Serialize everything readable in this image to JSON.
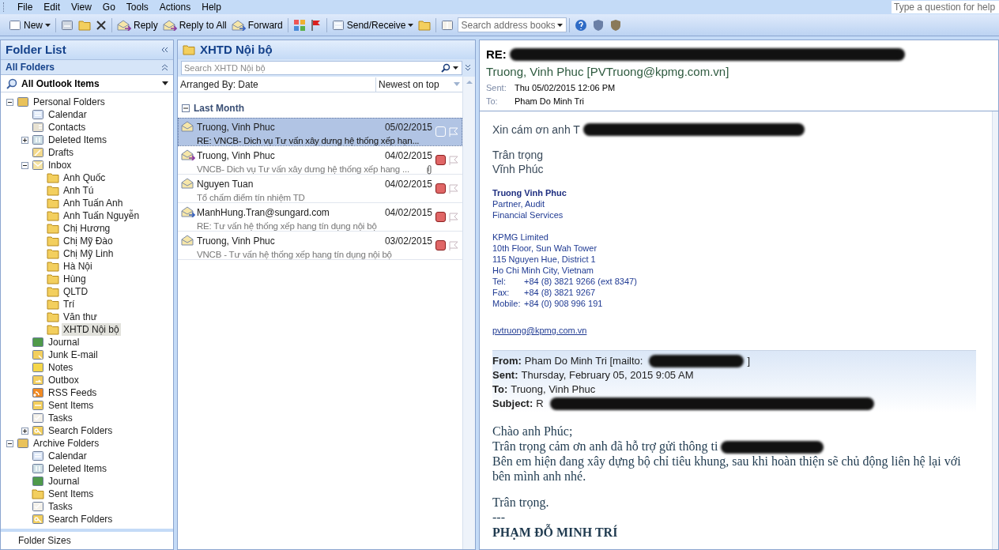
{
  "menu": [
    {
      "label": "File"
    },
    {
      "label": "Edit"
    },
    {
      "label": "View"
    },
    {
      "label": "Go"
    },
    {
      "label": "Tools"
    },
    {
      "label": "Actions"
    },
    {
      "label": "Help"
    }
  ],
  "help_box": {
    "placeholder": "Type a question for help"
  },
  "toolbar": {
    "new": "New",
    "reply": "Reply",
    "reply_all": "Reply to All",
    "forward": "Forward",
    "send_receive": "Send/Receive",
    "address_search": {
      "placeholder": "Search address books"
    }
  },
  "folder_pane": {
    "title": "Folder List",
    "section": "All Folders",
    "view_selector": "All Outlook Items",
    "footer": "Folder Sizes",
    "tree": [
      {
        "label": "Personal Folders",
        "kind": "root",
        "selected": false,
        "expanded": true,
        "children": [
          {
            "label": "Calendar",
            "kind": "calendar",
            "selected": false
          },
          {
            "label": "Contacts",
            "kind": "contacts",
            "selected": false
          },
          {
            "label": "Deleted Items",
            "kind": "deleted",
            "selected": false,
            "expanded": false
          },
          {
            "label": "Drafts",
            "kind": "drafts",
            "selected": false
          },
          {
            "label": "Inbox",
            "kind": "inbox",
            "selected": false,
            "expanded": true,
            "children": [
              {
                "label": "Anh Quốc",
                "kind": "folder",
                "selected": false
              },
              {
                "label": "Anh Tú",
                "kind": "folder",
                "selected": false
              },
              {
                "label": "Anh Tuấn Anh",
                "kind": "folder",
                "selected": false
              },
              {
                "label": "Anh Tuấn Nguyễn",
                "kind": "folder",
                "selected": false
              },
              {
                "label": "Chị Hương",
                "kind": "folder",
                "selected": false
              },
              {
                "label": "Chị Mỹ Đào",
                "kind": "folder",
                "selected": false
              },
              {
                "label": "Chị Mỹ Linh",
                "kind": "folder",
                "selected": false
              },
              {
                "label": "Hà Nội",
                "kind": "folder",
                "selected": false
              },
              {
                "label": "Hùng",
                "kind": "folder",
                "selected": false
              },
              {
                "label": "QLTD",
                "kind": "folder",
                "selected": false
              },
              {
                "label": "Trí",
                "kind": "folder",
                "selected": false
              },
              {
                "label": "Văn thư",
                "kind": "folder",
                "selected": false
              },
              {
                "label": "XHTD Nội bộ",
                "kind": "folder",
                "selected": true
              }
            ]
          },
          {
            "label": "Journal",
            "kind": "journal",
            "selected": false
          },
          {
            "label": "Junk E-mail",
            "kind": "junk",
            "selected": false
          },
          {
            "label": "Notes",
            "kind": "notes",
            "selected": false
          },
          {
            "label": "Outbox",
            "kind": "outbox",
            "selected": false
          },
          {
            "label": "RSS Feeds",
            "kind": "rss",
            "selected": false
          },
          {
            "label": "Sent Items",
            "kind": "sent",
            "selected": false
          },
          {
            "label": "Tasks",
            "kind": "tasks",
            "selected": false
          },
          {
            "label": "Search Folders",
            "kind": "search",
            "selected": false,
            "expanded": false
          }
        ]
      },
      {
        "label": "Archive Folders",
        "kind": "root",
        "selected": false,
        "expanded": true,
        "children": [
          {
            "label": "Calendar",
            "kind": "calendar",
            "selected": false
          },
          {
            "label": "Deleted Items",
            "kind": "deleted",
            "selected": false
          },
          {
            "label": "Journal",
            "kind": "journal",
            "selected": false
          },
          {
            "label": "Sent Items",
            "kind": "folder",
            "selected": false
          },
          {
            "label": "Tasks",
            "kind": "tasks",
            "selected": false
          },
          {
            "label": "Search Folders",
            "kind": "search",
            "selected": false
          }
        ]
      }
    ]
  },
  "message_list": {
    "title": "XHTD Nội bộ",
    "search": {
      "placeholder": "Search XHTD Nội bộ"
    },
    "arranged_by": "Arranged By: Date",
    "sort_order": "Newest on top",
    "group": {
      "label": "Last Month",
      "expanded": true
    },
    "rows": [
      {
        "sender": "Truong, Vinh Phuc",
        "date": "05/02/2015",
        "subject": "RE: VNCB- Dich vụ Tư vấn xây dưng hệ thống xếp hạn...",
        "kind": "read",
        "attachment": false,
        "selected": true
      },
      {
        "sender": "Truong, Vinh Phuc",
        "date": "04/02/2015",
        "subject": "VNCB- Dich vụ Tư vấn xây dưng hệ thống xếp hang ...",
        "kind": "replied",
        "attachment": true,
        "selected": false,
        "color": "#e06666"
      },
      {
        "sender": "Nguyen Tuan",
        "date": "04/02/2015",
        "subject": "Tổ chấm điểm tín nhiệm TD",
        "kind": "read",
        "attachment": false,
        "selected": false,
        "color": "#e06666"
      },
      {
        "sender": "ManhHung.Tran@sungard.com",
        "date": "04/02/2015",
        "subject": "RE: Tư vấn hệ thống xếp hang tín dụng nội bộ",
        "kind": "forwarded",
        "attachment": false,
        "selected": false,
        "color": "#e06666"
      },
      {
        "sender": "Truong, Vinh Phuc",
        "date": "03/02/2015",
        "subject": "VNCB - Tư vấn hệ thống xếp hang tín dụng nội bộ",
        "kind": "read",
        "attachment": false,
        "selected": false,
        "color": "#e06666"
      }
    ]
  },
  "reading_pane": {
    "subject": "RE:",
    "from": "Truong, Vinh Phuc [PVTruong@kpmg.com.vn]",
    "sent_label": "Sent:",
    "sent": "Thu 05/02/2015 12:06 PM",
    "to_label": "To:",
    "to": "Pham Do Minh Tri",
    "body": [
      {
        "kind": "text",
        "lines": [
          {
            "text": "Xin cám ơn anh T",
            "redacted": true
          }
        ]
      },
      {
        "kind": "text",
        "lines": [
          {
            "text": "Trân trọng",
            "redacted": false
          },
          {
            "text": "Vĩnh Phúc",
            "redacted": false
          }
        ]
      },
      {
        "kind": "signature",
        "lines": [
          {
            "text": "Truong Vinh Phuc",
            "kind": "name"
          },
          {
            "text": "Partner, Audit",
            "kind": "plain"
          },
          {
            "text": "Financial Services",
            "kind": "plain"
          }
        ]
      },
      {
        "kind": "signature",
        "lines": [
          {
            "text": "KPMG Limited",
            "kind": "plain"
          },
          {
            "text": "10th Floor, Sun Wah Tower",
            "kind": "plain"
          },
          {
            "text": "115 Nguyen Hue, District 1",
            "kind": "plain"
          },
          {
            "text": "Ho Chi Minh City, Vietnam",
            "kind": "plain"
          }
        ]
      },
      {
        "kind": "fields",
        "items": [
          {
            "label": "Tel:",
            "value": "+84 (8) 3821 9266 (ext 8347)"
          },
          {
            "label": "Fax:",
            "value": "+84 (8) 3821 9267"
          },
          {
            "label": "Mobile:",
            "value": "+84 (0) 908 996 191"
          }
        ]
      },
      {
        "kind": "link",
        "text": "pvtruong@kpmg.com.vn"
      },
      {
        "kind": "header",
        "items": [
          {
            "label": "From:",
            "value": "Pham Do Minh Tri [mailto:",
            "redacted": true,
            "suffix": "]"
          },
          {
            "label": "Sent:",
            "value": "Thursday, February 05, 2015 9:05 AM",
            "redacted": false
          },
          {
            "label": "To:",
            "value": "Truong, Vinh Phuc",
            "redacted": false
          },
          {
            "label": "Subject:",
            "value": "R",
            "redacted": true
          }
        ]
      },
      {
        "kind": "serif",
        "lines": [
          {
            "text": "Chào anh Phúc;",
            "redacted": false
          },
          {
            "text": "Trân trọng cảm ơn anh đã hỗ trợ gửi thông ti",
            "redacted": true
          },
          {
            "text": "Bên em hiện đang xây dựng bộ chỉ tiêu khung, sau khi hoàn thiện sẽ chủ động liên hệ lại với bên mình anh nhé.",
            "redacted": false
          }
        ]
      },
      {
        "kind": "serif",
        "lines": [
          {
            "text": "Trân trọng.",
            "redacted": false
          },
          {
            "text": "---",
            "redacted": false
          }
        ]
      },
      {
        "kind": "serif-bold",
        "lines": [
          {
            "text": "PHẠM ĐỖ MINH TRÍ",
            "redacted": false
          }
        ]
      }
    ]
  }
}
